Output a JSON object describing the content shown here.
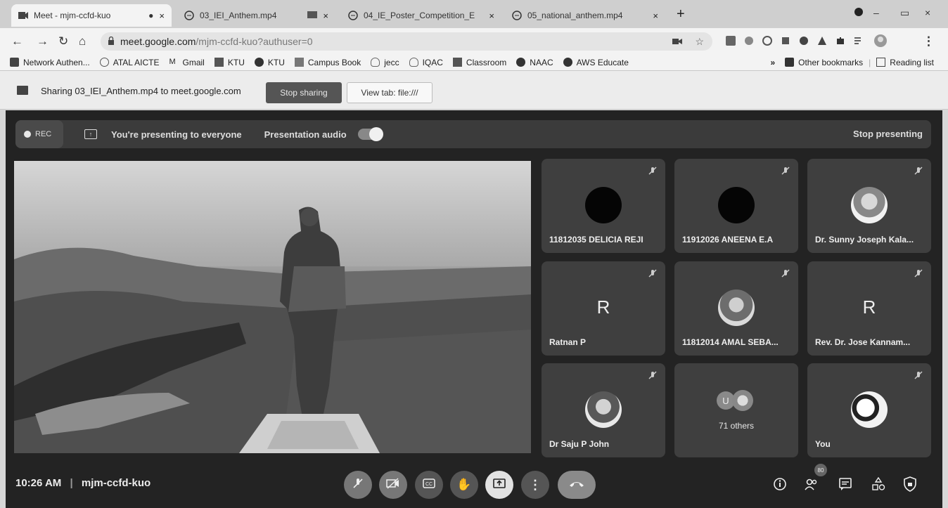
{
  "tabs": [
    {
      "title": "Meet - mjm-ccfd-kuo",
      "recording": "●",
      "close": "×"
    },
    {
      "title": "03_IEI_Anthem.mp4",
      "close": "×"
    },
    {
      "title": "04_IE_Poster_Competition_E",
      "close": "×"
    },
    {
      "title": "05_national_anthem.mp4",
      "close": "×"
    }
  ],
  "new_tab": "+",
  "window_controls": {
    "minimize": "–",
    "maximize": "▭",
    "close": "×"
  },
  "omnibox": {
    "host": "meet.google.com",
    "path": "/mjm-ccfd-kuo?authuser=0"
  },
  "bookmarks": [
    "Network Authen...",
    "ATAL AICTE",
    "Gmail",
    "KTU",
    "KTU",
    "Campus Book",
    "jecc",
    "IQAC",
    "Classroom",
    "NAAC",
    "AWS Educate"
  ],
  "bookmarks_more": "»",
  "other_bookmarks": "Other bookmarks",
  "reading_list": "Reading list",
  "infobar": {
    "message": "Sharing 03_IEI_Anthem.mp4 to meet.google.com",
    "stop_label": "Stop sharing",
    "view_label": "View tab: file:///"
  },
  "meet": {
    "rec_label": "REC",
    "presenting_label": "You're presenting to everyone",
    "audio_label": "Presentation audio",
    "stop_presenting_label": "Stop presenting",
    "time": "10:26 AM",
    "meeting_code": "mjm-ccfd-kuo",
    "participant_badge": "80"
  },
  "participants": [
    {
      "name": "11812035 DELICIA REJI",
      "avatar": "black-circle"
    },
    {
      "name": "11912026 ANEENA E.A",
      "avatar": "black-circle"
    },
    {
      "name": "Dr. Sunny Joseph Kala...",
      "avatar": "photo"
    },
    {
      "name": "Ratnan P",
      "letter": "R"
    },
    {
      "name": "11812014 AMAL SEBA...",
      "avatar": "photo"
    },
    {
      "name": "Rev. Dr. Jose Kannam...",
      "letter": "R"
    },
    {
      "name": "Dr Saju P John",
      "avatar": "photo"
    },
    {
      "name": "71 others",
      "letter": "U"
    },
    {
      "name": "You",
      "avatar": "penguin"
    }
  ],
  "colors": {
    "meet_bg": "#232323",
    "tile_bg": "#3f3f3f"
  }
}
